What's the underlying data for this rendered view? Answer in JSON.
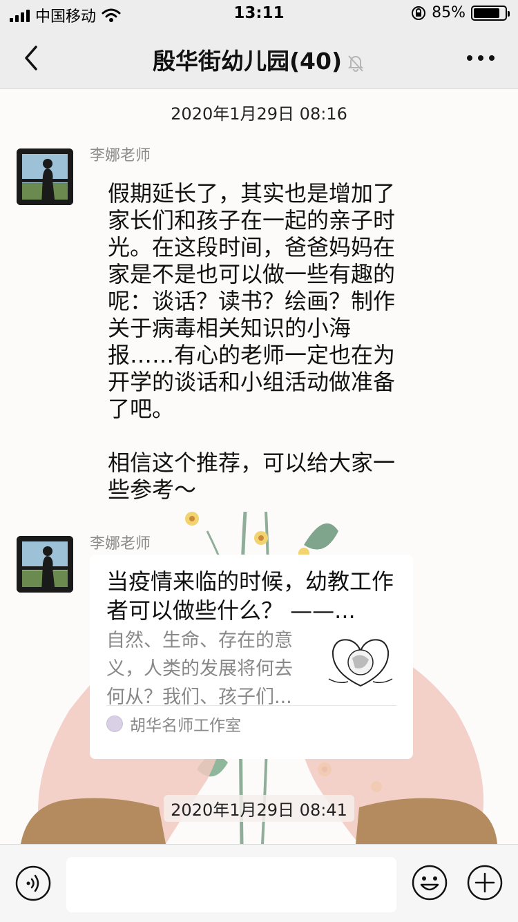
{
  "status_bar": {
    "carrier": "中国移动",
    "time": "13:11",
    "battery_pct_label": "85%",
    "battery_level": 0.85
  },
  "nav": {
    "title": "殷华街幼儿园(40)"
  },
  "messages": [
    {
      "timestamp": "2020年1月29日 08:16",
      "sender": "李娜老师",
      "text": "假期延长了，其实也是增加了家长们和孩子在一起的亲子时光。在这段时间，爸爸妈妈在家是不是也可以做一些有趣的呢：谈话？读书？绘画？制作关于病毒相关知识的小海报……有心的老师一定也在为开学的谈话和小组活动做准备了吧。\n\n相信这个推荐，可以给大家一些参考～"
    },
    {
      "sender": "李娜老师",
      "card": {
        "title": "当疫情来临的时候，幼教工作者可以做些什么？ ——...",
        "description": "自然、生命、存在的意义，人类的发展将何去何从？我们、孩子们...",
        "source": "胡华名师工作室"
      }
    }
  ],
  "timestamp_2": "2020年1月29日 08:41",
  "input": {
    "value": "",
    "placeholder": ""
  },
  "colors": {
    "nav_bg": "#ededed",
    "chat_bg": "#fdfbfa",
    "input_bar_bg": "#f6f6f6"
  },
  "icons": {
    "back": "chevron-left-icon",
    "mute": "bell-off-icon",
    "more": "more-dots-icon",
    "voice": "voice-icon",
    "emoji": "emoji-icon",
    "plus": "plus-circle-icon"
  }
}
